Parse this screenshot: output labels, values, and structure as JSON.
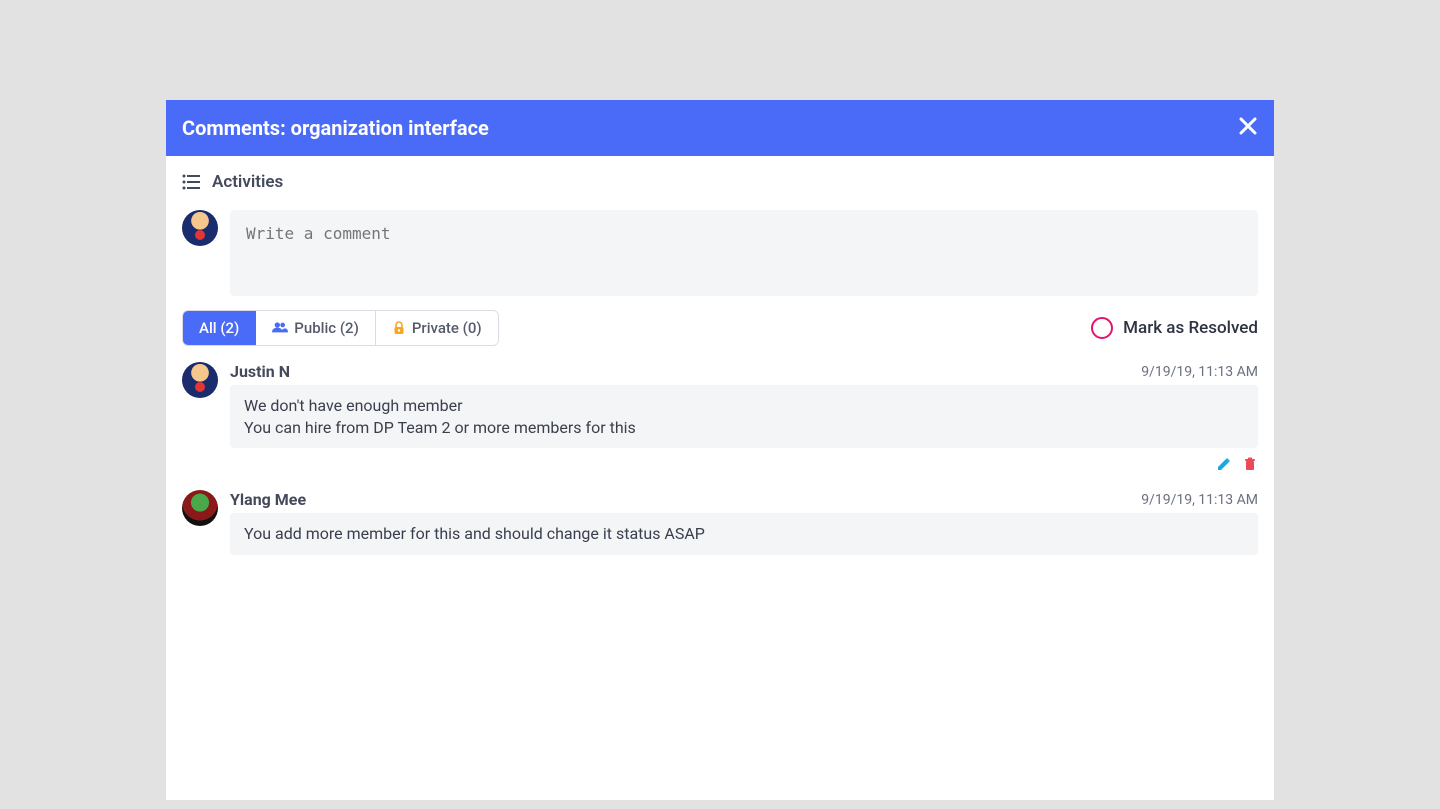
{
  "header": {
    "title": "Comments: organization interface"
  },
  "activities_label": "Activities",
  "composer": {
    "placeholder": "Write a comment"
  },
  "tabs": {
    "all": "All (2)",
    "public": "Public (2)",
    "private": "Private (0)"
  },
  "resolve_label": "Mark as Resolved",
  "comments": [
    {
      "author": "Justin N",
      "time": "9/19/19, 11:13 AM",
      "body": "We don't have enough member\nYou can hire from DP Team 2 or more members for this",
      "editable": true
    },
    {
      "author": "Ylang Mee",
      "time": "9/19/19, 11:13 AM",
      "body": "You add more member for this and should change it status ASAP",
      "editable": false
    }
  ],
  "colors": {
    "primary": "#4a6bf7",
    "accent": "#e8136f",
    "edit": "#16a9e6",
    "delete": "#ea4a59"
  }
}
